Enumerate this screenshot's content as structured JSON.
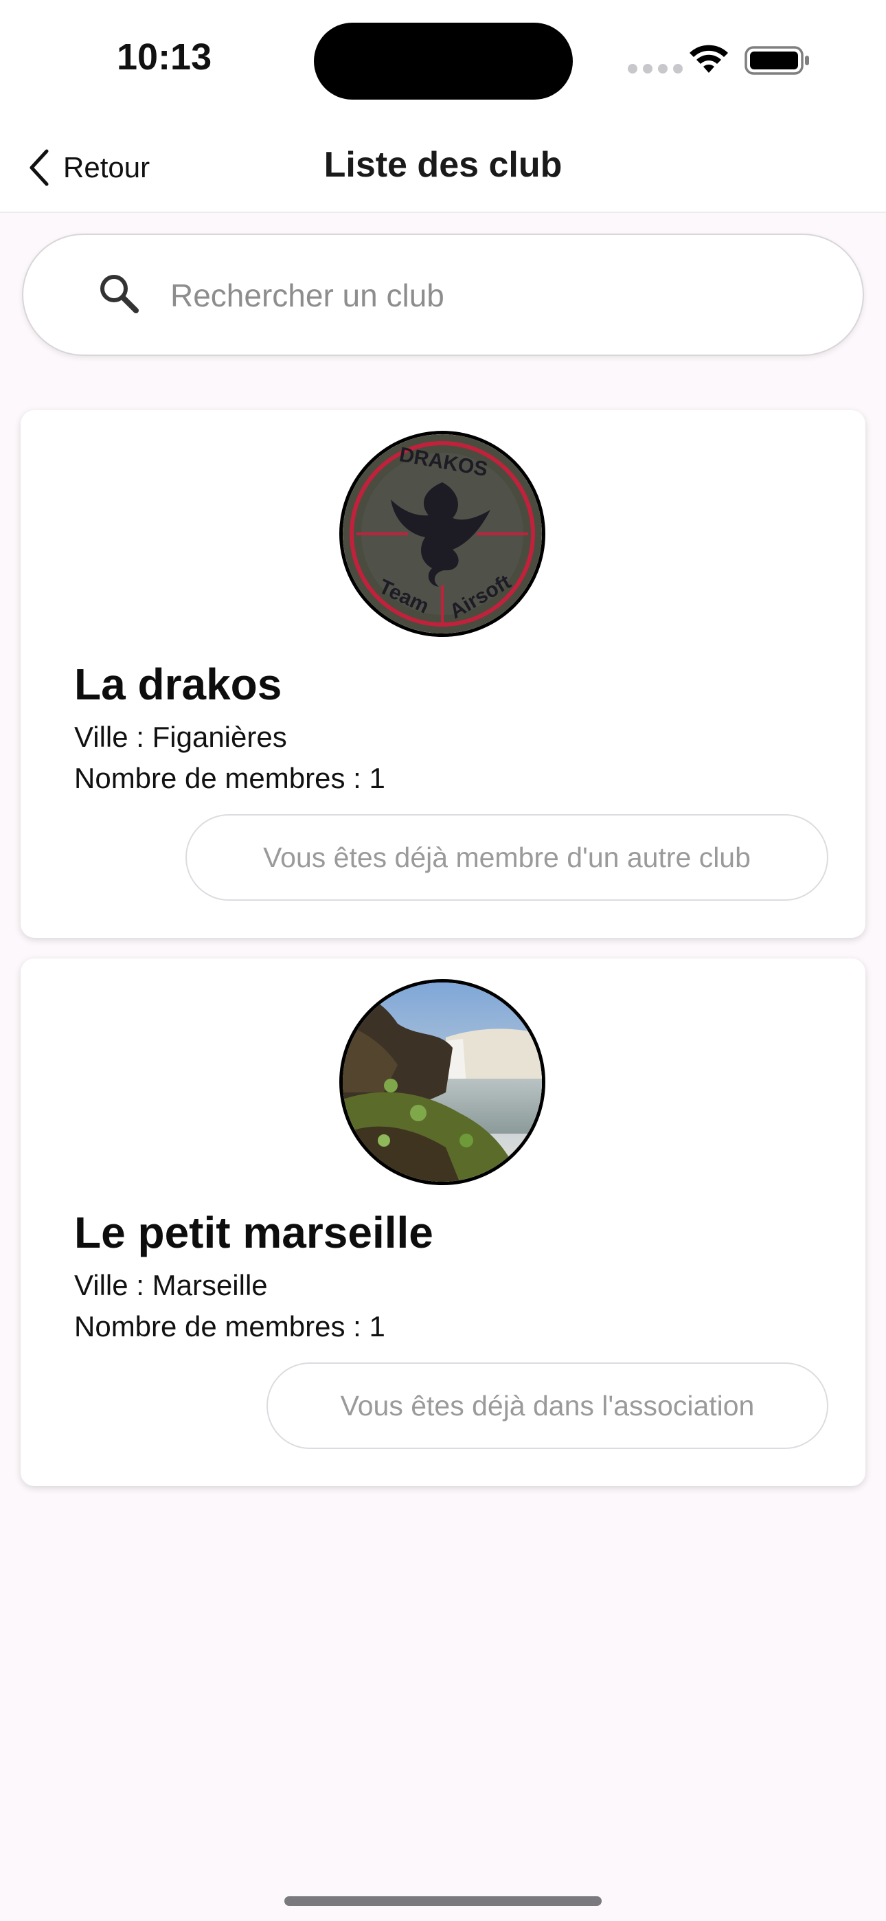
{
  "status_bar": {
    "time": "10:13"
  },
  "nav": {
    "back_label": "Retour",
    "title": "Liste des club"
  },
  "search": {
    "placeholder": "Rechercher un club",
    "value": ""
  },
  "clubs": [
    {
      "name": "La drakos",
      "city": "Ville : Figanières",
      "members": "Nombre de membres : 1",
      "button_label": "Vous êtes déjà membre d'un autre club",
      "image": "drakos-team-airsoft-patch",
      "patch_text_top": "DRAKOS",
      "patch_text_left": "Team",
      "patch_text_right": "Airsoft"
    },
    {
      "name": "Le petit marseille",
      "city": "Ville : Marseille",
      "members": "Nombre de membres : 1",
      "button_label": "Vous êtes déjà dans l'association",
      "image": "waterfall-photo"
    }
  ],
  "colors": {
    "background": "#fcf8fb",
    "card": "#ffffff",
    "disabled_text": "#9a9a9a",
    "patch_red": "#c2213b",
    "patch_olive": "#4b4c40"
  }
}
